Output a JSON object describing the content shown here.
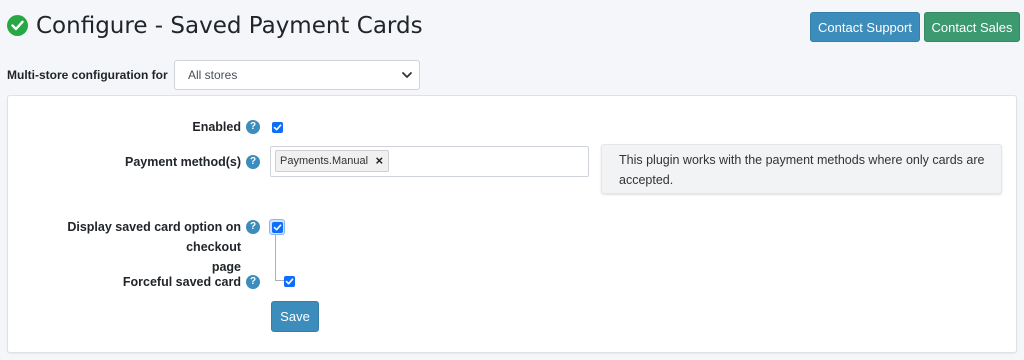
{
  "header": {
    "title": "Configure - Saved Payment Cards",
    "contact_support": "Contact Support",
    "contact_sales": "Contact Sales"
  },
  "store_config": {
    "label": "Multi-store configuration for",
    "selected": "All stores"
  },
  "form": {
    "enabled": {
      "label": "Enabled",
      "checked": true
    },
    "payment_methods": {
      "label": "Payment method(s)",
      "tags": [
        "Payments.Manual"
      ],
      "tag_remove": "×"
    },
    "info": "This plugin works with the payment methods where only cards are accepted.",
    "display_saved_card": {
      "label_line1": "Display saved card option on checkout",
      "label_line2": "page",
      "checked": true
    },
    "forceful_saved_card": {
      "label": "Forceful saved card",
      "checked": true
    },
    "help_glyph": "?",
    "save_label": "Save"
  },
  "colors": {
    "primary": "#3c8dbc",
    "success": "#3d9970",
    "check_green": "#28a745",
    "checkbox": "#0d6efd"
  },
  "icons": {
    "title": "check-circle-icon",
    "help": "question-circle-icon",
    "select": "chevron-down-icon",
    "remove": "close-icon"
  }
}
